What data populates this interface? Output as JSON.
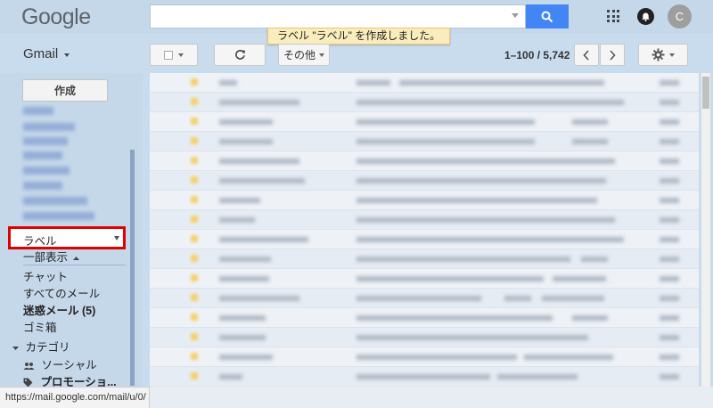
{
  "header": {
    "logo": "Google",
    "search": {
      "value": "",
      "placeholder": ""
    },
    "avatar_letter": "C"
  },
  "toast": "ラベル \"ラベル\" を作成しました。",
  "toolbar": {
    "app_switch_label": "Gmail",
    "more_label": "その他",
    "pagination": "1–100 / 5,742"
  },
  "sidebar": {
    "compose_label": "作成",
    "label_item": "ラベル",
    "show_less": "一部表示",
    "items": [
      {
        "label": "チャット",
        "bold": false
      },
      {
        "label": "すべてのメール",
        "bold": false
      },
      {
        "label": "迷惑メール (5)",
        "bold": true
      },
      {
        "label": "ゴミ箱",
        "bold": false
      }
    ],
    "category_label": "カテゴリ",
    "categories": [
      {
        "label": "ソーシャル",
        "bold": false
      },
      {
        "label": "プロモーショ...",
        "bold": true
      }
    ]
  },
  "status_bar": {
    "url": "https://mail.google.com/mail/u/0/"
  },
  "colors": {
    "accent": "#4285f4",
    "highlight": "#e00000",
    "toast_bg": "#f9edbe"
  }
}
